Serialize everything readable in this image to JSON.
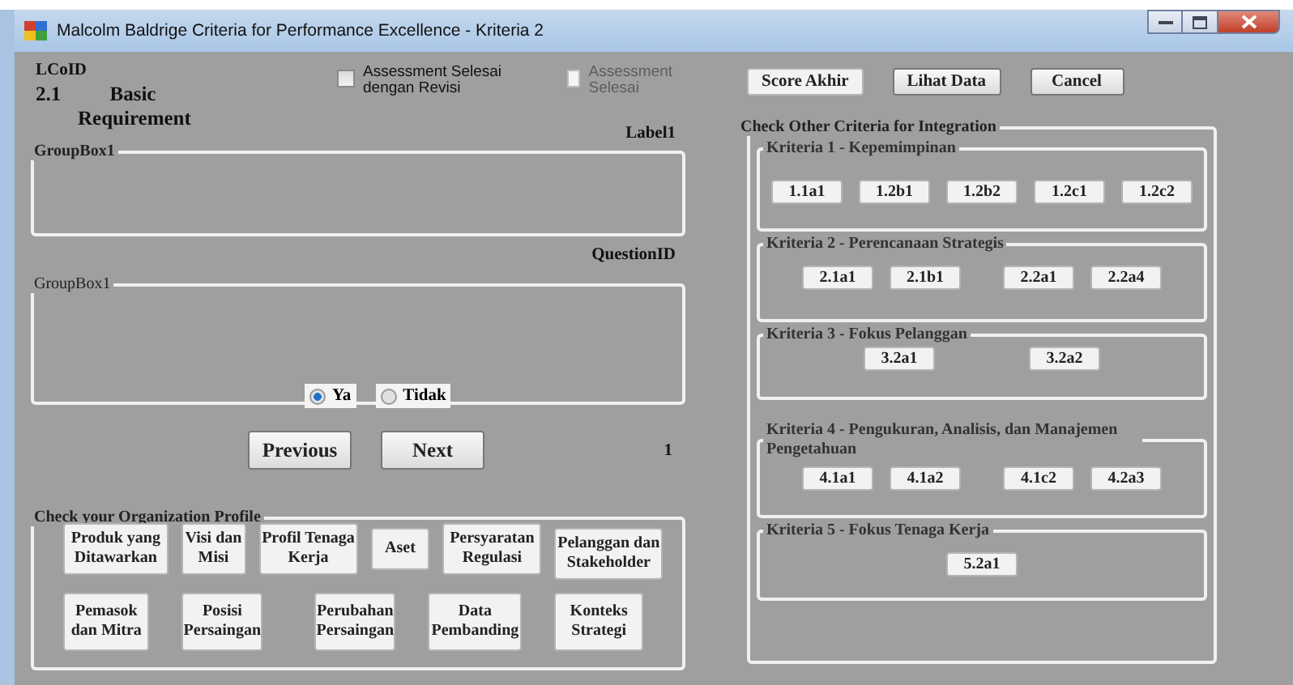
{
  "window": {
    "title": "Malcolm Baldrige Criteria for Performance Excellence - Kriteria 2"
  },
  "header": {
    "lcoid": "LCoID",
    "code": "2.1",
    "name": "Basic Requirement",
    "label1": "Label1"
  },
  "checkboxes": [
    {
      "label": "Assessment Selesai dengan Revisi",
      "checked": false,
      "disabled": false
    },
    {
      "label": "Assessment Selesai",
      "checked": false,
      "disabled": true
    }
  ],
  "actions": [
    "Score Akhir",
    "Lihat Data",
    "Cancel"
  ],
  "group_top": {
    "title": "GroupBox1"
  },
  "question_id": "QuestionID",
  "group_question": {
    "title": "GroupBox1"
  },
  "answers": [
    {
      "label": "Ya",
      "selected": true
    },
    {
      "label": "Tidak",
      "selected": false
    }
  ],
  "navigation": [
    "Previous",
    "Next"
  ],
  "page_number": "1",
  "profile": {
    "title": "Check your Organization Profile",
    "rows": [
      {
        "buttons": [
          "Produk yang Ditawarkan",
          "Visi dan Misi",
          "Profil Tenaga Kerja",
          "Aset",
          "Persyaratan Regulasi",
          "Pelanggan dan Stakeholder"
        ]
      },
      {
        "buttons": [
          "Pemasok dan Mitra",
          "Posisi Persaingan",
          "Perubahan Persaingan",
          "Data Pembanding",
          "Konteks Strategi"
        ]
      }
    ]
  },
  "criteria": {
    "title": "Check Other Criteria for Integration",
    "groups": [
      {
        "title": "Kriteria 1 - Kepemimpinan",
        "buttons": [
          "1.1a1",
          "1.2b1",
          "1.2b2",
          "1.2c1",
          "1.2c2"
        ]
      },
      {
        "title": "Kriteria 2 - Perencanaan Strategis",
        "buttons": [
          "2.1a1",
          "2.1b1",
          "2.2a1",
          "2.2a4"
        ]
      },
      {
        "title": "Kriteria 3 - Fokus Pelanggan",
        "buttons": [
          "3.2a1",
          "3.2a2"
        ]
      },
      {
        "title": "Kriteria 4 - Pengukuran, Analisis, dan Manajemen Pengetahuan",
        "buttons": [
          "4.1a1",
          "4.1a2",
          "4.1c2",
          "4.2a3"
        ]
      },
      {
        "title": "Kriteria 5 - Fokus Tenaga Kerja",
        "buttons": [
          "5.2a1"
        ]
      }
    ]
  }
}
